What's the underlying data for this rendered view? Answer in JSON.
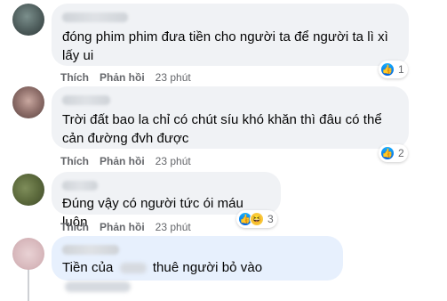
{
  "comments": [
    {
      "text": "đóng phim phim đưa tiền cho người ta để người ta lì xì lấy ui",
      "actions": {
        "like": "Thích",
        "reply": "Phản hồi",
        "time": "23 phút"
      },
      "reaction_count": "1"
    },
    {
      "text": "Trời đất bao la chỉ có chút síu khó khăn thì đâu có thể cản đường đvh được",
      "actions": {
        "like": "Thích",
        "reply": "Phản hồi",
        "time": "23 phút"
      },
      "reaction_count": "2"
    },
    {
      "text": "Đúng vậy có người tức ói máu luôn",
      "actions": {
        "like": "Thích",
        "reply": "Phản hồi",
        "time": "23 phút"
      },
      "reaction_count": "3"
    },
    {
      "text_before": "Tiền của",
      "text_after": "thuê người bỏ vào"
    }
  ],
  "icons": {
    "like": "like-reaction-icon",
    "haha": "haha-reaction-icon"
  },
  "colors": {
    "bubble": "#f0f2f5",
    "reply_bubble": "#e7f0fd",
    "meta_text": "#65676b",
    "like_blue": "#0062df"
  }
}
